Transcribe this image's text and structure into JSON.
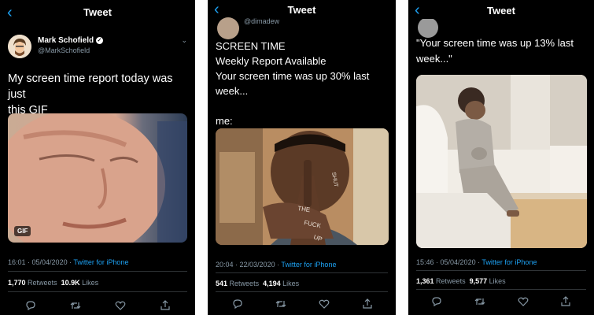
{
  "panels": [
    {
      "header": {
        "back_icon": "chevron-left-icon",
        "title": "Tweet"
      },
      "author": {
        "name": "Mark Schofield",
        "handle": "@MarkSchofield",
        "verified": true
      },
      "text": "My screen time report today was just\nthis GIF",
      "media": {
        "badge": "GIF"
      },
      "meta": {
        "time": "16:01",
        "date": "05/04/2020",
        "client": "Twitter for iPhone"
      },
      "stats": {
        "retweets": "1,770",
        "retweets_label": "Retweets",
        "likes": "10.9K",
        "likes_label": "Likes"
      }
    },
    {
      "header": {
        "back_icon": "chevron-left-icon",
        "title": "Tweet"
      },
      "handle_partial": "@dimadew",
      "text": "SCREEN TIME\nWeekly Report Available\nYour screen time was up 30% last\nweek...\n\nme:",
      "meta": {
        "time": "20:04",
        "date": "22/03/2020",
        "client": "Twitter for iPhone"
      },
      "stats": {
        "retweets": "541",
        "retweets_label": "Retweets",
        "likes": "4,194",
        "likes_label": "Likes"
      }
    },
    {
      "header": {
        "back_icon": "chevron-left-icon",
        "title": "Tweet"
      },
      "text": "\"Your screen time was up 13% last\nweek...\"",
      "meta": {
        "time": "15:46",
        "date": "05/04/2020",
        "client": "Twitter for iPhone"
      },
      "stats": {
        "retweets": "1,361",
        "retweets_label": "Retweets",
        "likes": "9,577",
        "likes_label": "Likes"
      }
    }
  ],
  "action_icons": [
    "reply-icon",
    "retweet-icon",
    "like-icon",
    "share-icon"
  ],
  "colors": {
    "background": "#000000",
    "accent": "#1da1f2",
    "muted": "#8899a6",
    "divider": "#2f3336"
  }
}
